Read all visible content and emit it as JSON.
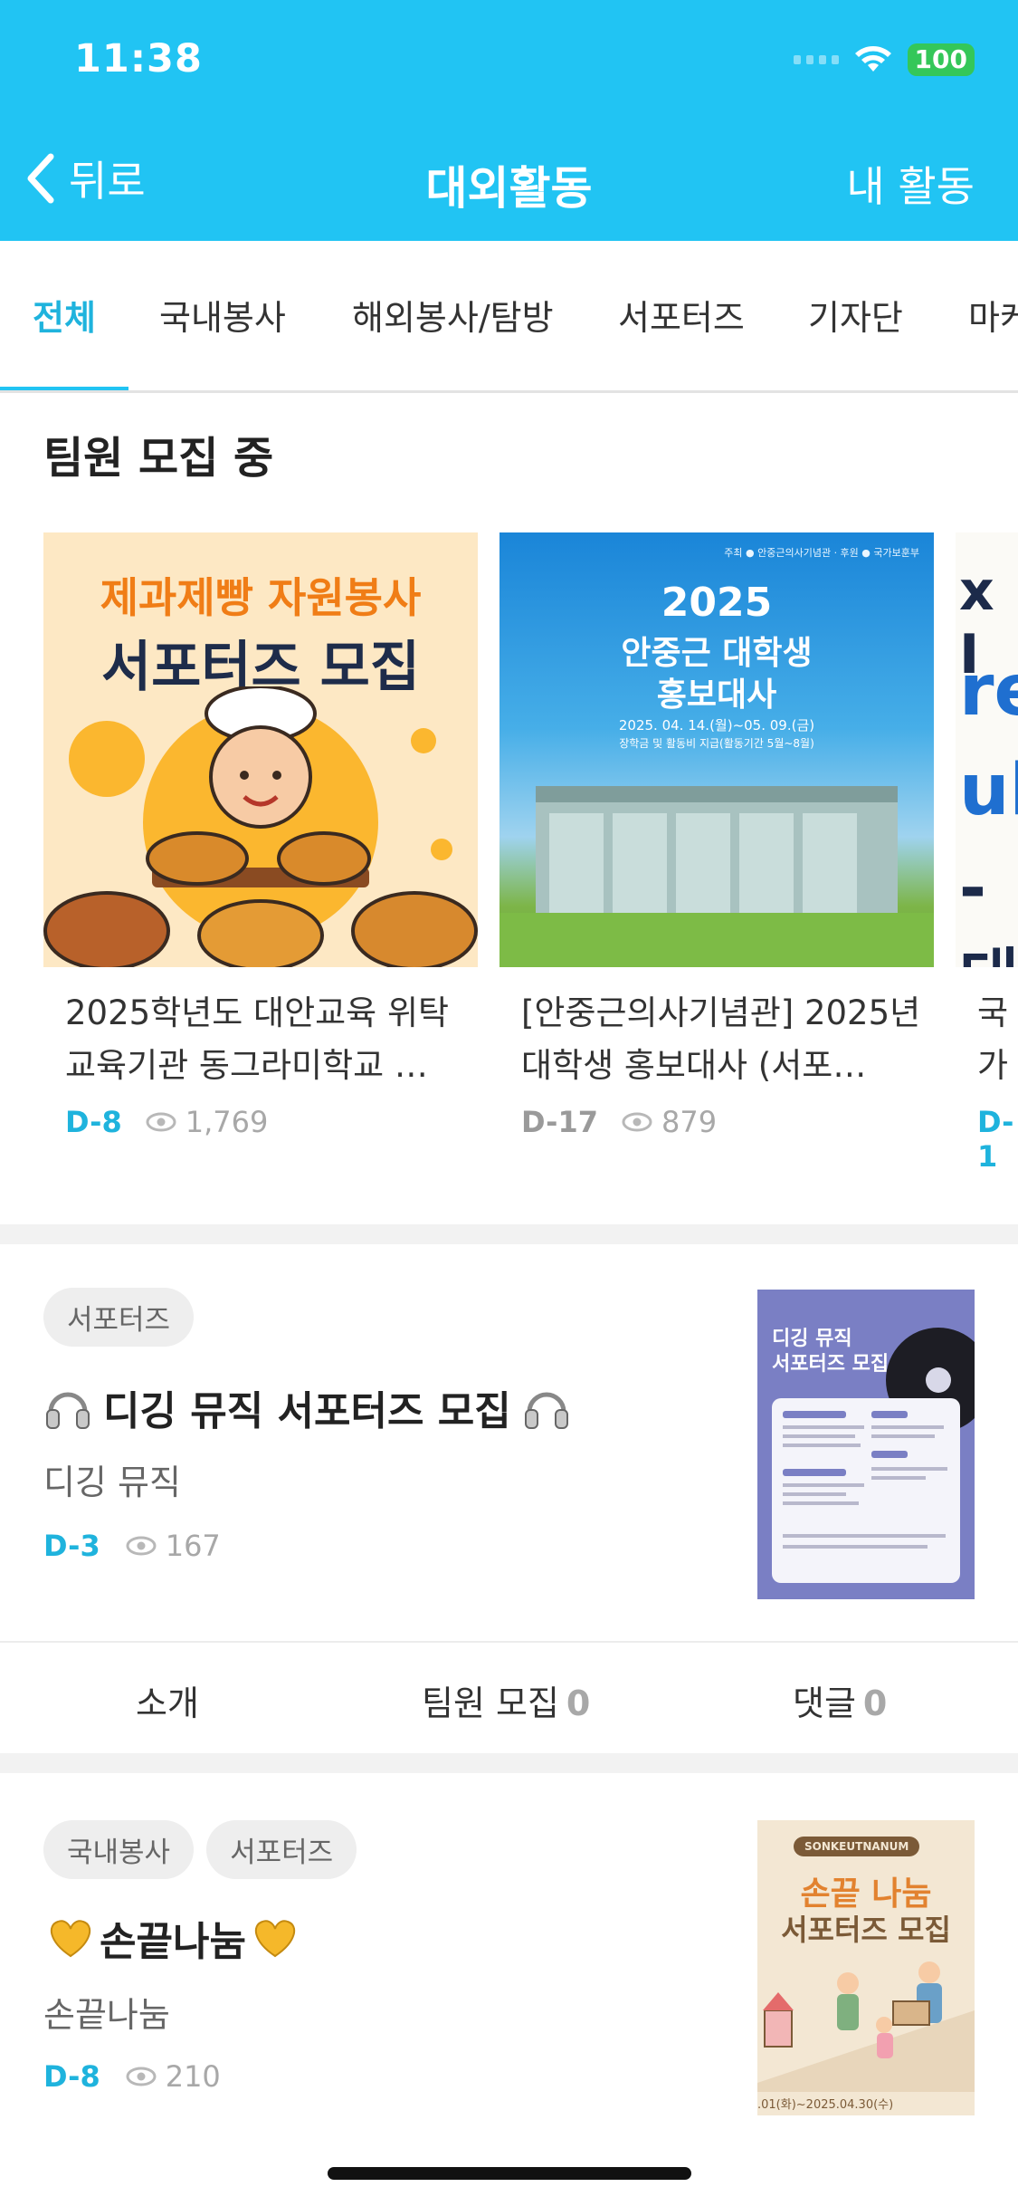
{
  "status_bar": {
    "time": "11:38",
    "battery": "100"
  },
  "nav": {
    "back_label": "뒤로",
    "title": "대외활동",
    "my_activity": "내 활동"
  },
  "tabs": [
    {
      "label": "전체",
      "active": true
    },
    {
      "label": "국내봉사"
    },
    {
      "label": "해외봉사/탐방"
    },
    {
      "label": "서포터즈"
    },
    {
      "label": "기자단"
    },
    {
      "label": "마케"
    }
  ],
  "section": {
    "title": "팀원 모집 중"
  },
  "cards": [
    {
      "poster_line1": "제과제빵 자원봉사",
      "poster_line2": "서포터즈 모집",
      "title": "2025학년도 대안교육 위탁 교육기관 동그라미학교 …",
      "dday": "D-8",
      "views": "1,769"
    },
    {
      "poster_top": "주최 ● 안중근의사기념관 · 후원 ● 국가보훈부",
      "poster_year": "2025",
      "poster_line1": "안중근 대학생",
      "poster_line2": "홍보대사",
      "poster_dates": "2025. 04. 14.(월)~05. 09.(금)",
      "poster_note": "장학금 및 활동비 지급(활동기간 5월~8월)",
      "title": "[안중근의사기념관] 2025년 대학생 홍보대사 (서포…",
      "dday": "D-17",
      "views": "879"
    },
    {
      "poster_text": [
        "x I",
        "re",
        "ul",
        "-대"
      ],
      "title": "국가 로그",
      "dday": "D-1"
    }
  ],
  "items": [
    {
      "tags": [
        "서포터즈"
      ],
      "title": "디깅 뮤직 서포터즈 모집",
      "subtitle": "디깅 뮤직",
      "dday": "D-3",
      "views": "167",
      "poster_line1": "디깅 뮤직",
      "poster_line2": "서포터즈 모집",
      "tabs": {
        "intro": "소개",
        "members": "팀원 모집",
        "members_count": "0",
        "comments": "댓글",
        "comments_count": "0"
      }
    },
    {
      "tags": [
        "국내봉사",
        "서포터즈"
      ],
      "title": "손끝나눔",
      "subtitle": "손끝나눔",
      "dday": "D-8",
      "views": "210",
      "poster_badge": "SONKEUTNANUM",
      "poster_line1": "손끝 나눔",
      "poster_line2": "서포터즈 모집",
      "poster_dates": ".01(화)~2025.04.30(수)"
    }
  ],
  "colors": {
    "accent": "#21c4f3",
    "accent_text": "#1fb3dd",
    "battery": "#34c759"
  }
}
